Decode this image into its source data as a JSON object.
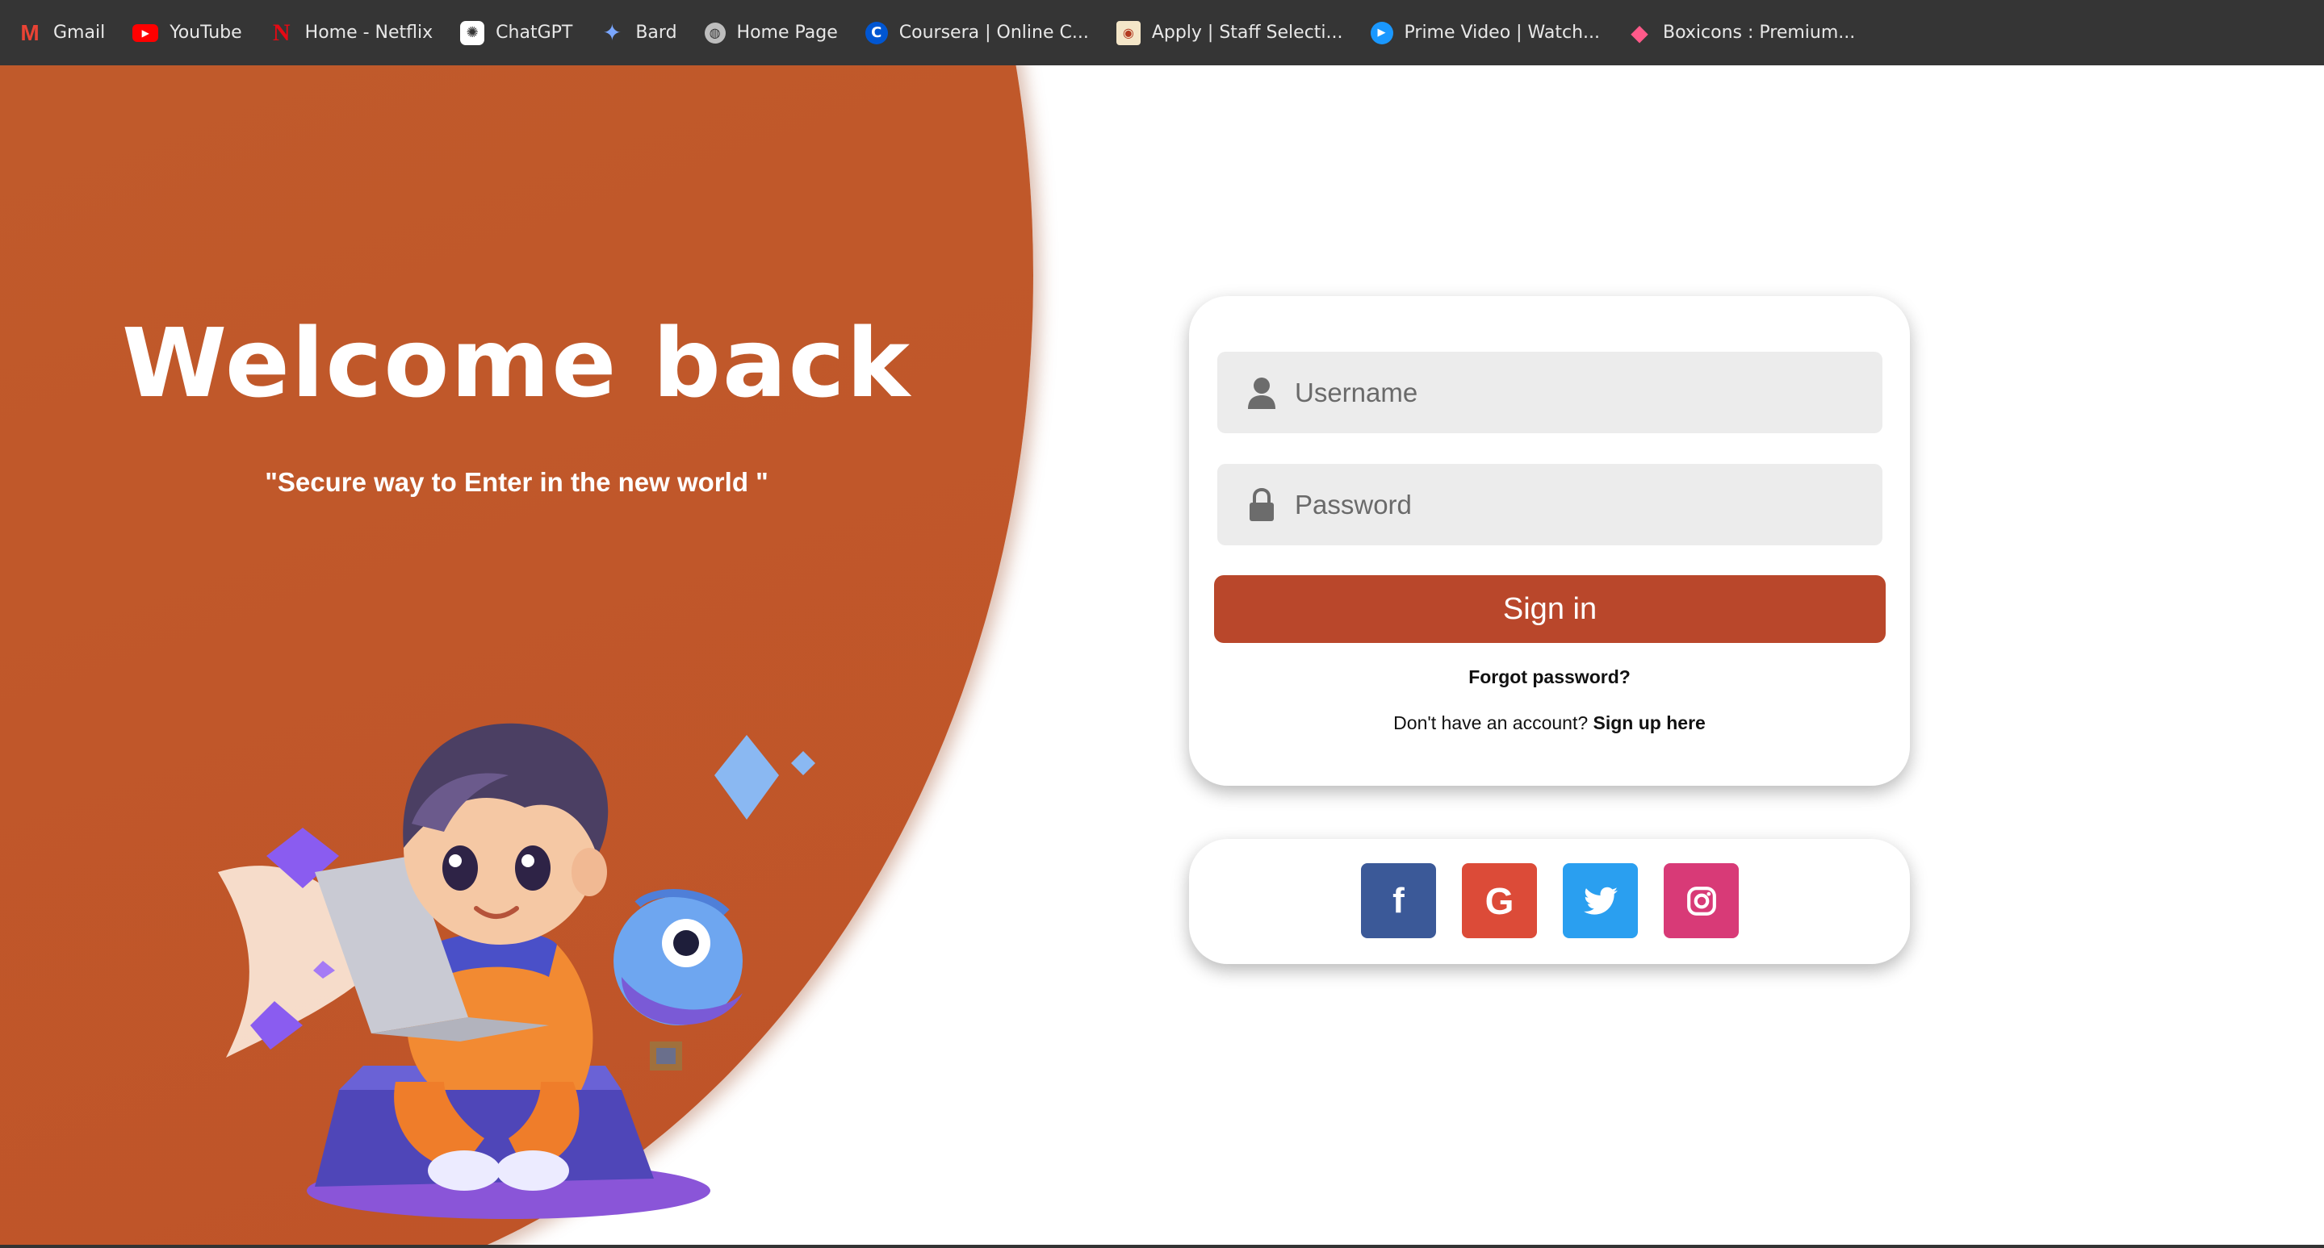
{
  "bookmarks": [
    {
      "label": "Gmail",
      "icon": "gmail-icon"
    },
    {
      "label": "YouTube",
      "icon": "youtube-icon"
    },
    {
      "label": "Home - Netflix",
      "icon": "netflix-icon"
    },
    {
      "label": "ChatGPT",
      "icon": "chatgpt-icon"
    },
    {
      "label": "Bard",
      "icon": "bard-icon"
    },
    {
      "label": "Home Page",
      "icon": "globe-icon"
    },
    {
      "label": "Coursera | Online C...",
      "icon": "coursera-icon"
    },
    {
      "label": "Apply | Staff Selecti...",
      "icon": "ssc-icon"
    },
    {
      "label": "Prime Video | Watch...",
      "icon": "prime-video-icon"
    },
    {
      "label": "Boxicons : Premium...",
      "icon": "boxicons-icon"
    }
  ],
  "hero": {
    "title": "Welcome back",
    "tagline": "\"Secure way to Enter in the new world \"",
    "accent_color": "#bf5a2b"
  },
  "login": {
    "username_placeholder": "Username",
    "password_placeholder": "Password",
    "signin_label": "Sign in",
    "forgot_label": "Forgot password?",
    "signup_prompt": "Don't have an account?",
    "signup_link": "Sign up here",
    "button_color": "#b9472b"
  },
  "social": [
    {
      "name": "facebook",
      "icon": "facebook-icon",
      "color": "#3b5998"
    },
    {
      "name": "google",
      "icon": "google-icon",
      "color": "#dc4b38"
    },
    {
      "name": "twitter",
      "icon": "twitter-icon",
      "color": "#2a9ff0"
    },
    {
      "name": "instagram",
      "icon": "instagram-icon",
      "color": "#d83a77"
    }
  ]
}
